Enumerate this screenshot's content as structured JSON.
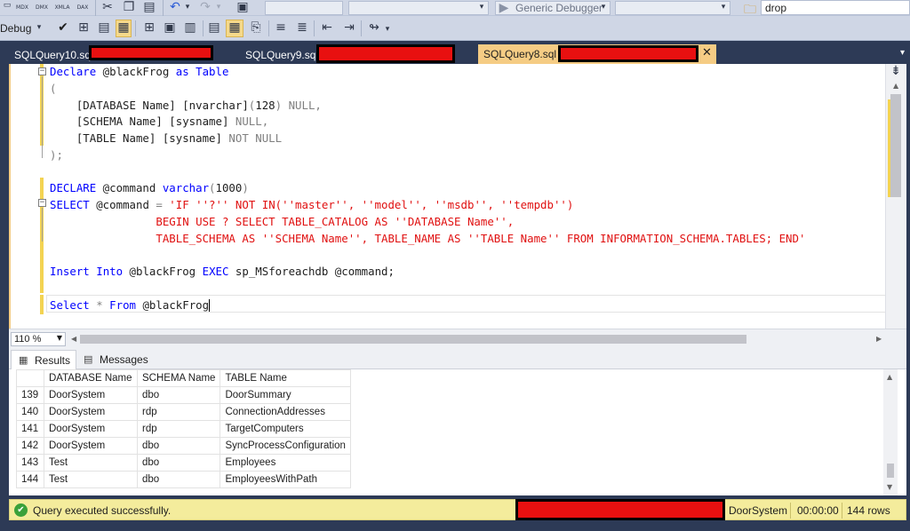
{
  "toolbar1": {
    "icons": [
      "mdx-icon",
      "dmx-icon",
      "xmla-icon",
      "dax-icon"
    ],
    "icon_labels": [
      "MDX",
      "DMX",
      "XMLA",
      "DAX"
    ],
    "debugger_label": "Generic Debugger",
    "search_value": "drop"
  },
  "toolbar2": {
    "debug_label": "Debug"
  },
  "tabs": [
    {
      "label": "SQLQuery10.sql",
      "active": false
    },
    {
      "label": "SQLQuery9.sql",
      "active": false
    },
    {
      "label": "SQLQuery8.sql -",
      "active": true
    }
  ],
  "editor": {
    "lines": [
      [
        {
          "t": "Declare",
          "c": "kw"
        },
        {
          "t": " @blackFrog ",
          "c": "txt"
        },
        {
          "t": "as",
          "c": "kw"
        },
        {
          "t": " ",
          "c": "txt"
        },
        {
          "t": "Table",
          "c": "kw"
        }
      ],
      [
        {
          "t": "(",
          "c": "gray"
        }
      ],
      [
        {
          "t": "    [DATABASE Name] [nvarchar]",
          "c": "txt"
        },
        {
          "t": "(",
          "c": "gray"
        },
        {
          "t": "128",
          "c": "txt"
        },
        {
          "t": ")",
          "c": "gray"
        },
        {
          "t": " NULL,",
          "c": "gray"
        }
      ],
      [
        {
          "t": "    [SCHEMA Name] [sysname] ",
          "c": "txt"
        },
        {
          "t": "NULL,",
          "c": "gray"
        }
      ],
      [
        {
          "t": "    [TABLE Name] [sysname] ",
          "c": "txt"
        },
        {
          "t": "NOT NULL",
          "c": "gray"
        }
      ],
      [
        {
          "t": ");",
          "c": "gray"
        }
      ],
      [],
      [
        {
          "t": "DECLARE",
          "c": "kw"
        },
        {
          "t": " @command ",
          "c": "txt"
        },
        {
          "t": "varchar",
          "c": "kw"
        },
        {
          "t": "(",
          "c": "gray"
        },
        {
          "t": "1000",
          "c": "txt"
        },
        {
          "t": ")",
          "c": "gray"
        }
      ],
      [
        {
          "t": "SELECT",
          "c": "kw"
        },
        {
          "t": " @command ",
          "c": "txt"
        },
        {
          "t": "=",
          "c": "gray"
        },
        {
          "t": " 'IF ''?'' NOT IN(''master'', ''model'', ''msdb'', ''tempdb'')",
          "c": "str"
        }
      ],
      [
        {
          "t": "                BEGIN USE ? SELECT TABLE_CATALOG AS ''DATABASE Name'',",
          "c": "str"
        }
      ],
      [
        {
          "t": "                TABLE_SCHEMA AS ''SCHEMA Name'', TABLE_NAME AS ''TABLE Name'' FROM INFORMATION_SCHEMA.TABLES; END'",
          "c": "str"
        }
      ],
      [],
      [
        {
          "t": "Insert",
          "c": "kw"
        },
        {
          "t": " ",
          "c": "txt"
        },
        {
          "t": "Into",
          "c": "kw"
        },
        {
          "t": " @blackFrog ",
          "c": "txt"
        },
        {
          "t": "EXEC",
          "c": "kw"
        },
        {
          "t": " sp_MSforeachdb @command;",
          "c": "txt"
        }
      ],
      [],
      [
        {
          "t": "Select",
          "c": "kw"
        },
        {
          "t": " ",
          "c": "txt"
        },
        {
          "t": "*",
          "c": "gray"
        },
        {
          "t": " ",
          "c": "txt"
        },
        {
          "t": "From",
          "c": "kw"
        },
        {
          "t": " @blackFrog",
          "c": "txt"
        }
      ]
    ]
  },
  "zoom": {
    "value": "110 %"
  },
  "results_tabs": [
    {
      "label": "Results",
      "icon": "grid-icon"
    },
    {
      "label": "Messages",
      "icon": "messages-icon"
    }
  ],
  "grid": {
    "columns": [
      "DATABASE Name",
      "SCHEMA Name",
      "TABLE Name"
    ],
    "rows": [
      {
        "num": "139",
        "cells": [
          "DoorSystem",
          "dbo",
          "DoorSummary"
        ]
      },
      {
        "num": "140",
        "cells": [
          "DoorSystem",
          "rdp",
          "ConnectionAddresses"
        ]
      },
      {
        "num": "141",
        "cells": [
          "DoorSystem",
          "rdp",
          "TargetComputers"
        ]
      },
      {
        "num": "142",
        "cells": [
          "DoorSystem",
          "dbo",
          "SyncProcessConfiguration"
        ]
      },
      {
        "num": "143",
        "cells": [
          "Test",
          "dbo",
          "Employees"
        ]
      },
      {
        "num": "144",
        "cells": [
          "Test",
          "dbo",
          "EmployeesWithPath"
        ]
      }
    ]
  },
  "status": {
    "message": "Query executed successfully.",
    "database": "DoorSystem",
    "elapsed": "00:00:00",
    "rows": "144 rows"
  },
  "colors": {
    "accent_tab": "#f5cc84",
    "status_bar": "#f4ec9c",
    "keyword": "#0000ff",
    "string": "#e01010",
    "redaction": "#e81010"
  }
}
